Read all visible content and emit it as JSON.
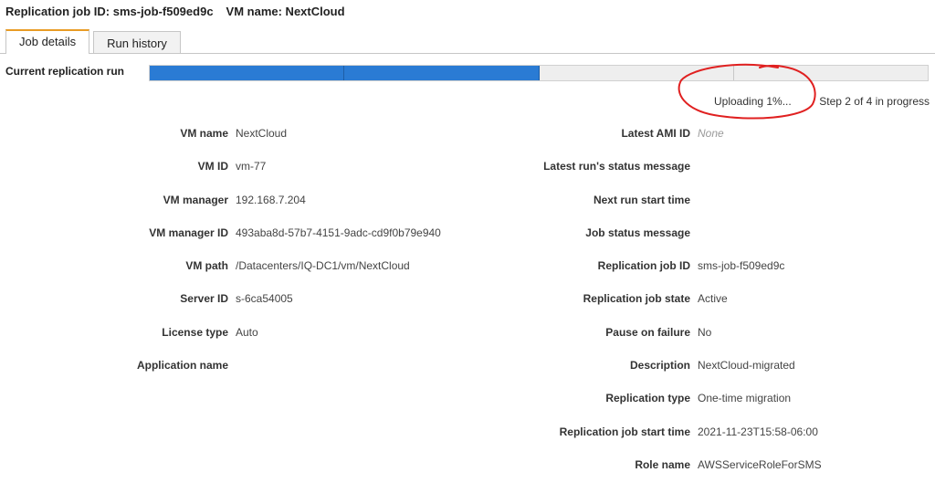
{
  "header": {
    "job_id_text": "Replication job ID: sms-job-f509ed9c",
    "vm_name_text": "VM name: NextCloud"
  },
  "tabs": [
    {
      "label": "Job details",
      "active": true
    },
    {
      "label": "Run history",
      "active": false
    }
  ],
  "progress": {
    "label": "Current replication run",
    "total_steps": 4,
    "completed_steps": 2,
    "upload_status": "Uploading 1%...",
    "step_status": "Step 2 of 4 in progress",
    "fill_color": "#2a7bd4",
    "annotation_color": "#e02020"
  },
  "details_left": [
    {
      "label": "VM name",
      "value": "NextCloud"
    },
    {
      "label": "VM ID",
      "value": "vm-77"
    },
    {
      "label": "VM manager",
      "value": "192.168.7.204"
    },
    {
      "label": "VM manager ID",
      "value": "493aba8d-57b7-4151-9adc-cd9f0b79e940"
    },
    {
      "label": "VM path",
      "value": "/Datacenters/IQ-DC1/vm/NextCloud"
    },
    {
      "label": "Server ID",
      "value": "s-6ca54005"
    },
    {
      "label": "License type",
      "value": "Auto"
    },
    {
      "label": "Application name",
      "value": ""
    }
  ],
  "details_right": [
    {
      "label": "Latest AMI ID",
      "value": "None"
    },
    {
      "label": "Latest run's status message",
      "value": ""
    },
    {
      "label": "Next run start time",
      "value": ""
    },
    {
      "label": "Job status message",
      "value": ""
    },
    {
      "label": "Replication job ID",
      "value": "sms-job-f509ed9c"
    },
    {
      "label": "Replication job state",
      "value": "Active"
    },
    {
      "label": "Pause on failure",
      "value": "No"
    },
    {
      "label": "Description",
      "value": "NextCloud-migrated"
    },
    {
      "label": "Replication type",
      "value": "One-time migration"
    },
    {
      "label": "Replication job start time",
      "value": "2021-11-23T15:58-06:00"
    },
    {
      "label": "Role name",
      "value": "AWSServiceRoleForSMS"
    }
  ]
}
